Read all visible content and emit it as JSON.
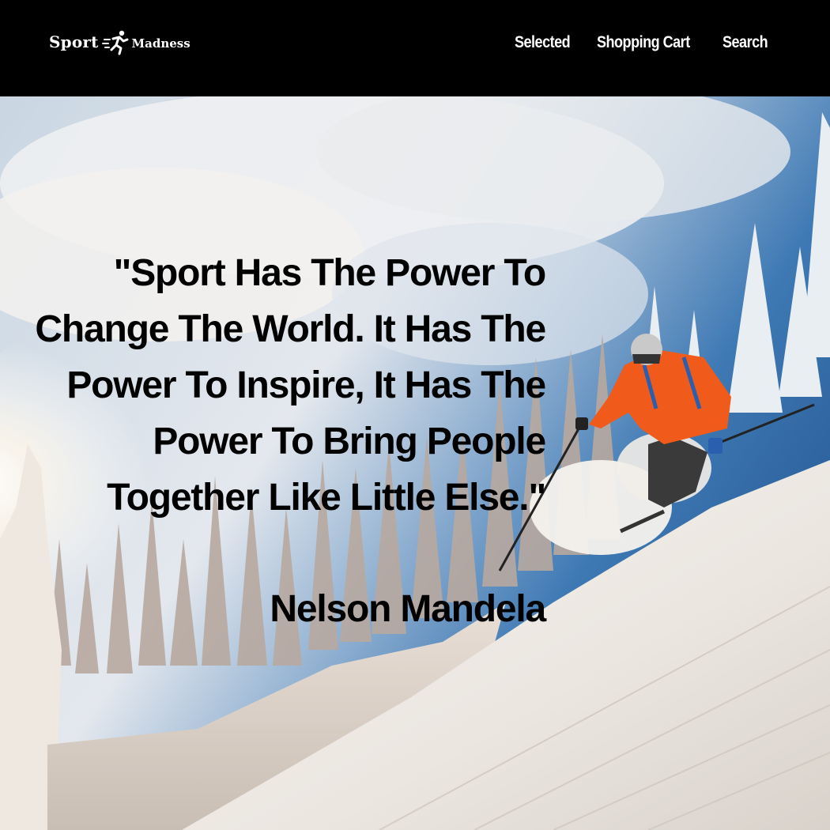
{
  "header": {
    "logo": {
      "word1": "Sport",
      "word2": "Madness",
      "icon": "running-person-icon"
    },
    "nav": [
      {
        "label": "Selected"
      },
      {
        "label": "Shopping Cart"
      },
      {
        "label": "Search"
      }
    ]
  },
  "hero": {
    "image": "skier-on-snowy-slope",
    "quote": "\"Sport Has The Power To Change The World. It Has The Power To Inspire, It Has The Power To Bring People Together Like Little Else.\"",
    "author": "Nelson Mandela"
  },
  "colors": {
    "header_bg": "#000000",
    "nav_text": "#ffffff",
    "quote_text": "#000000",
    "jacket": "#f05a1a",
    "sky": "#2f6aa8",
    "snow": "#f4f2ef"
  }
}
